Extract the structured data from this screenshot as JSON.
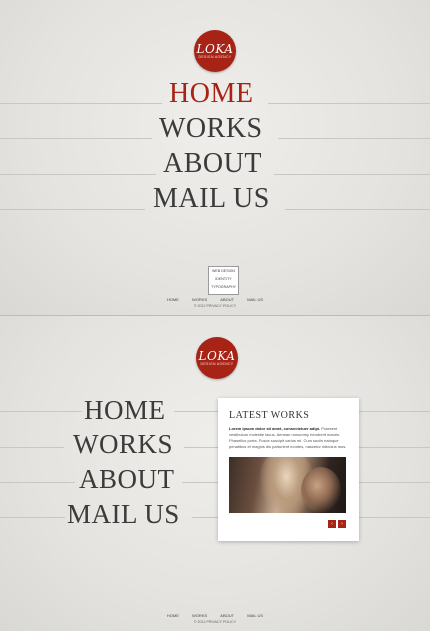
{
  "logo": {
    "mark": "LOKA",
    "tagline": "DESIGN AGENCY"
  },
  "menu": {
    "home": "HOME",
    "works": "WORKS",
    "about": "ABOUT",
    "mail": "MAIL US"
  },
  "submenu": [
    "WEB DESIGN",
    "IDENTITY",
    "TYPOGRAPHY"
  ],
  "footer_nav": [
    "HOME",
    "WORKS",
    "ABOUT",
    "MAIL US"
  ],
  "copyright": "© 2012 PRIVACY POLICY",
  "latest_works": {
    "title": "LATEST WORKS",
    "lead": "Lorem ipsum dolor sit amet, consectetuer adipi.",
    "body": "Praesent vestibulum molestie lacus. Aenean nonummy hendrerit mauris. Phasellus porta. Fusce suscipit varius mi. Cum sociis natoque penatibus et magnis dis parturient montes, nascetur ridiculus mus.",
    "prev_label": "‹",
    "next_label": "›"
  },
  "colors": {
    "accent": "#a72316",
    "background": "#e6e5e2",
    "text": "#3b3b3b"
  }
}
